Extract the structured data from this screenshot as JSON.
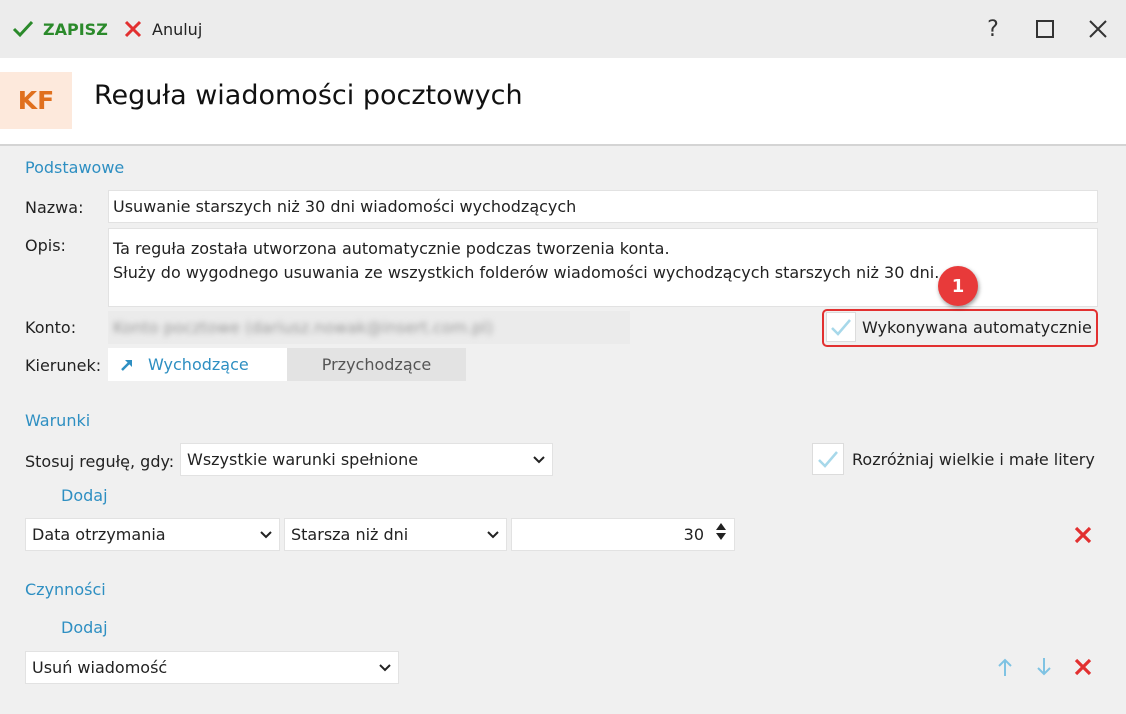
{
  "toolbar": {
    "save_label": "ZAPISZ",
    "cancel_label": "Anuluj",
    "help_label": "?"
  },
  "header": {
    "logo": "KF",
    "title": "Reguła wiadomości pocztowych"
  },
  "basic": {
    "section": "Podstawowe",
    "name_label": "Nazwa:",
    "name_value": "Usuwanie starszych niż 30 dni wiadomości wychodzących",
    "desc_label": "Opis:",
    "desc_line1": "Ta reguła została utworzona automatycznie podczas tworzenia konta.",
    "desc_line2": "Służy do wygodnego usuwania ze wszystkich folderów wiadomości wychodzących starszych niż 30 dni.",
    "account_label": "Konto:",
    "account_value": "Konto pocztowe (dariusz.nowak@insert.com.pl)",
    "auto_label": "Wykonywana automatycznie",
    "auto_checked": true,
    "badge": "1",
    "direction_label": "Kierunek:",
    "direction_out": "Wychodzące",
    "direction_in": "Przychodzące"
  },
  "conditions": {
    "section": "Warunki",
    "apply_label": "Stosuj regułę, gdy:",
    "apply_value": "Wszystkie warunki spełnione",
    "case_label": "Rozróżniaj wielkie i małe litery",
    "case_checked": true,
    "add_label": "Dodaj",
    "row": {
      "field": "Data otrzymania",
      "operator": "Starsza niż dni",
      "value": "30"
    }
  },
  "actions": {
    "section": "Czynności",
    "add_label": "Dodaj",
    "row": {
      "action": "Usuń wiadomość"
    }
  },
  "colors": {
    "accent": "#2e8fc2",
    "save_green": "#2b8a2b",
    "delete_red": "#e23030",
    "logo_orange": "#e0701e"
  }
}
